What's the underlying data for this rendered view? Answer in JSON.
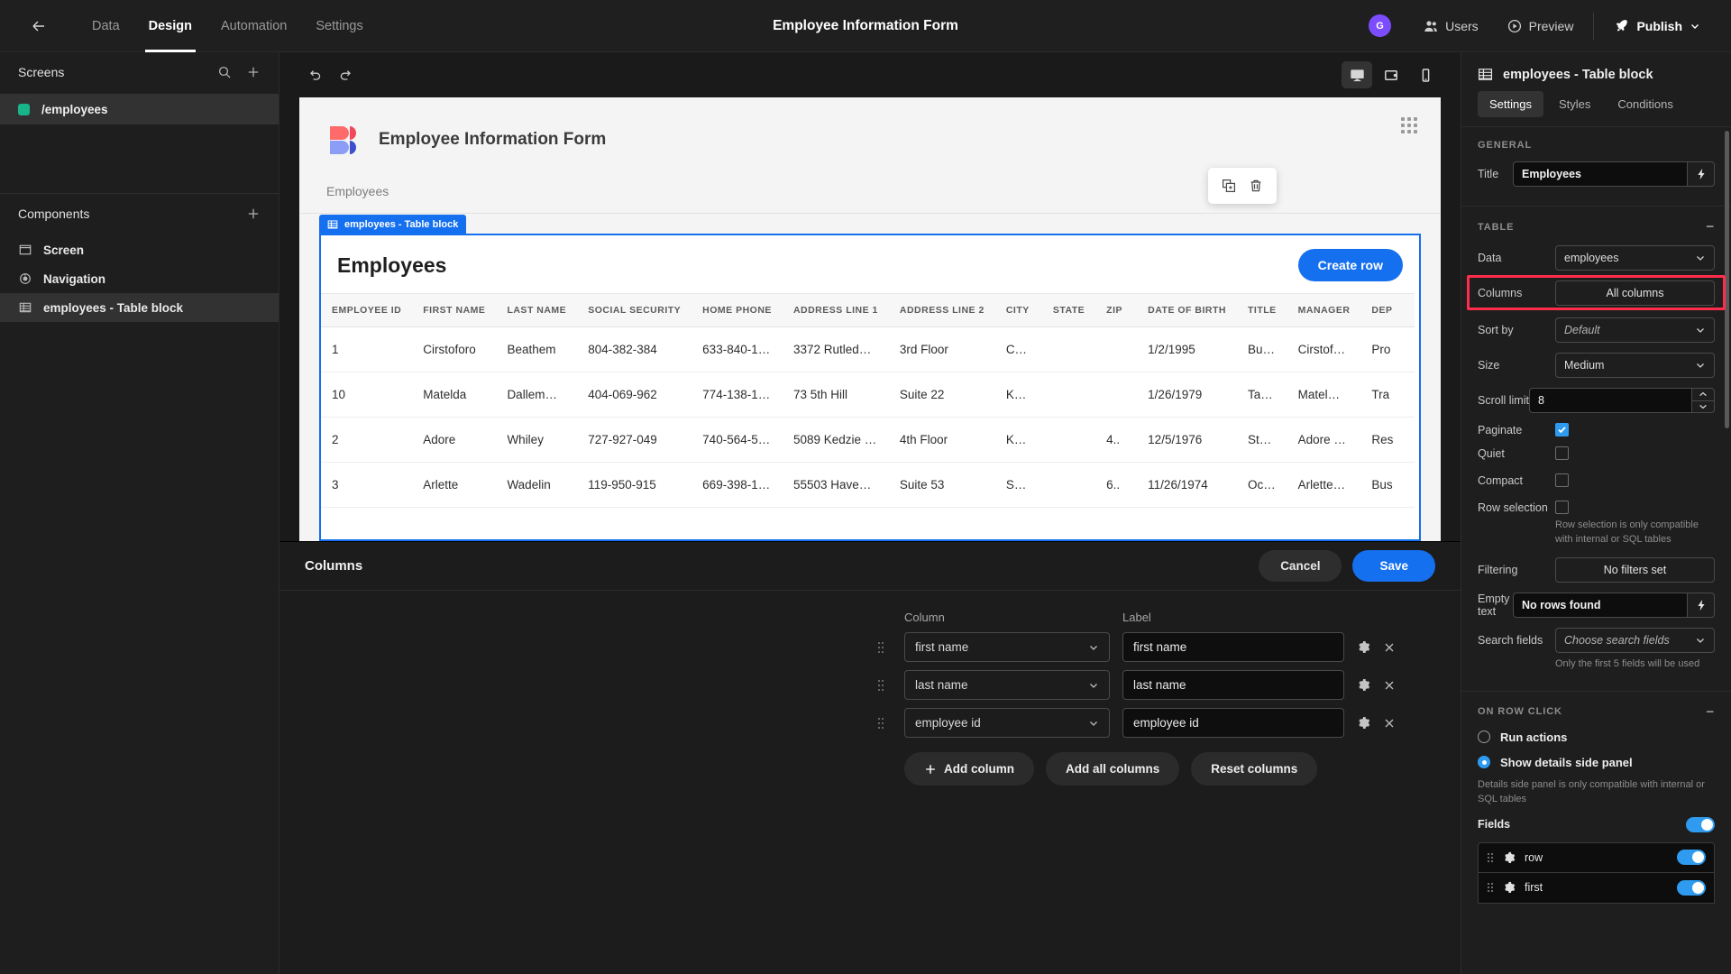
{
  "topbar": {
    "back_icon": "arrow-left-icon",
    "tabs": [
      {
        "label": "Data",
        "active": false
      },
      {
        "label": "Design",
        "active": true
      },
      {
        "label": "Automation",
        "active": false
      },
      {
        "label": "Settings",
        "active": false
      }
    ],
    "title": "Employee Information Form",
    "avatar_initial": "G",
    "avatar_color": "#7c4dff",
    "users_label": "Users",
    "preview_label": "Preview",
    "publish_label": "Publish"
  },
  "sidebar": {
    "screens_header": "Screens",
    "search_icon": "search-icon",
    "add_icon": "plus-icon",
    "screens": [
      {
        "label": "/employees",
        "color": "#18b58a",
        "selected": true
      }
    ],
    "components_header": "Components",
    "components_add_icon": "plus-icon",
    "components": [
      {
        "label": "Screen",
        "icon": "screen-icon",
        "selected": false
      },
      {
        "label": "Navigation",
        "icon": "navigation-icon",
        "selected": false
      },
      {
        "label": "employees - Table block",
        "icon": "table-icon",
        "selected": true
      }
    ]
  },
  "toolbar": {
    "undo_icon": "undo-icon",
    "redo_icon": "redo-icon",
    "devices": [
      {
        "name": "desktop",
        "active": true
      },
      {
        "name": "tablet",
        "active": false
      },
      {
        "name": "mobile",
        "active": false
      }
    ]
  },
  "canvas": {
    "app_title": "Employee Information Form",
    "nav_label": "Employees",
    "float_tools": [
      "duplicate-icon",
      "delete-icon"
    ],
    "block_tag": "employees - Table block",
    "block_title": "Employees",
    "create_row_label": "Create row",
    "table": {
      "columns": [
        "EMPLOYEE ID",
        "FIRST NAME",
        "LAST NAME",
        "SOCIAL SECURITY",
        "HOME PHONE",
        "ADDRESS LINE 1",
        "ADDRESS LINE 2",
        "CITY",
        "STATE",
        "ZIP",
        "DATE OF BIRTH",
        "TITLE",
        "MANAGER",
        "DEP"
      ],
      "rows": [
        [
          "1",
          "Cirstoforo",
          "Beathem",
          "804-382-384",
          "633-840-1…",
          "3372 Rutled…",
          "3rd Floor",
          "C…",
          "",
          "",
          "1/2/1995",
          "Bu…",
          "Cirstof…",
          "Pro"
        ],
        [
          "10",
          "Matelda",
          "Dallem…",
          "404-069-962",
          "774-138-1…",
          "73 5th Hill",
          "Suite 22",
          "K…",
          "",
          "",
          "1/26/1979",
          "Ta…",
          "Matel…",
          "Tra"
        ],
        [
          "2",
          "Adore",
          "Whiley",
          "727-927-049",
          "740-564-5…",
          "5089 Kedzie …",
          "4th Floor",
          "K…",
          "",
          "4..",
          "12/5/1976",
          "St…",
          "Adore …",
          "Res"
        ],
        [
          "3",
          "Arlette",
          "Wadelin",
          "119-950-915",
          "669-398-1…",
          "55503 Have…",
          "Suite 53",
          "S…",
          "",
          "6..",
          "11/26/1974",
          "Oc…",
          "Arlette…",
          "Bus"
        ]
      ]
    }
  },
  "drawer": {
    "title": "Columns",
    "cancel_label": "Cancel",
    "save_label": "Save",
    "col_header": "Column",
    "label_header": "Label",
    "rows": [
      {
        "column": "first name",
        "label": "first name"
      },
      {
        "column": "last name",
        "label": "last name"
      },
      {
        "column": "employee id",
        "label": "employee id"
      }
    ],
    "add_column_label": "Add column",
    "add_all_columns_label": "Add all columns",
    "reset_columns_label": "Reset columns",
    "settings_icon": "gear-icon",
    "remove_icon": "close-icon"
  },
  "rightpanel": {
    "header_title": "employees - Table block",
    "header_icon": "table-icon",
    "tabs": [
      {
        "label": "Settings",
        "active": true
      },
      {
        "label": "Styles",
        "active": false
      },
      {
        "label": "Conditions",
        "active": false
      }
    ],
    "general": {
      "section_label": "GENERAL",
      "title_label": "Title",
      "title_value": "Employees",
      "bolt_icon": "lightning-icon"
    },
    "table": {
      "section_label": "TABLE",
      "data_label": "Data",
      "data_value": "employees",
      "columns_label": "Columns",
      "columns_value": "All columns",
      "columns_highlight_color": "#ff2d4b",
      "sort_label": "Sort by",
      "sort_value": "Default",
      "size_label": "Size",
      "size_value": "Medium",
      "scroll_limit_label": "Scroll limit",
      "scroll_limit_value": "8",
      "paginate_label": "Paginate",
      "paginate_checked": true,
      "quiet_label": "Quiet",
      "quiet_checked": false,
      "compact_label": "Compact",
      "compact_checked": false,
      "row_selection_label": "Row selection",
      "row_selection_checked": false,
      "row_selection_hint": "Row selection is only compatible with internal or SQL tables",
      "filtering_label": "Filtering",
      "filtering_value": "No filters set",
      "empty_text_label": "Empty text",
      "empty_text_value": "No rows found",
      "search_fields_label": "Search fields",
      "search_fields_placeholder": "Choose search fields",
      "search_fields_hint": "Only the first 5 fields will be used"
    },
    "on_row_click": {
      "section_label": "ON ROW CLICK",
      "run_actions_label": "Run actions",
      "run_actions_selected": false,
      "show_details_label": "Show details side panel",
      "show_details_selected": true,
      "details_hint": "Details side panel is only compatible with internal or SQL tables",
      "fields_label": "Fields",
      "fields_enabled": true,
      "fields": [
        {
          "name": "row",
          "enabled": true
        },
        {
          "name": "first",
          "enabled": true
        }
      ]
    }
  }
}
